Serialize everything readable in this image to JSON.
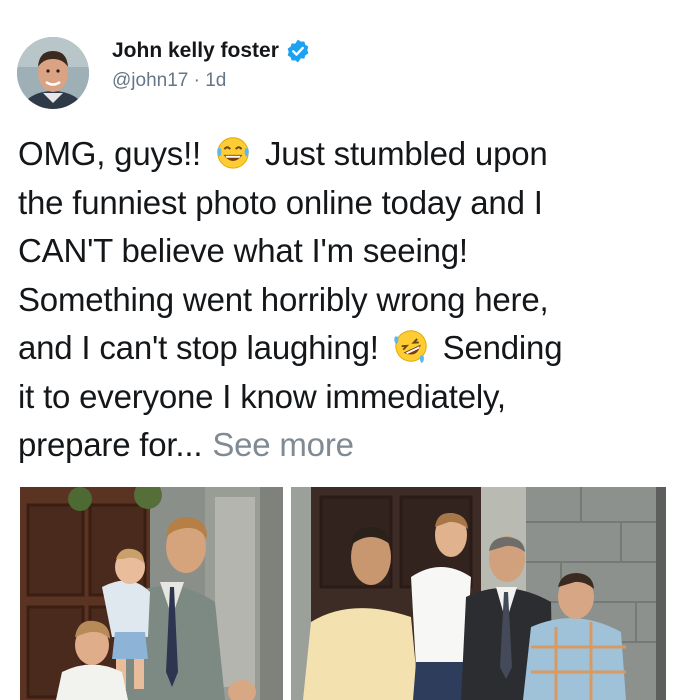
{
  "author": {
    "name": "John kelly foster",
    "handle": "@john17",
    "separator": " · ",
    "time": "1d",
    "verified": true,
    "avatar_icon": "profile-photo"
  },
  "tweet": {
    "lines": [
      {
        "before": "OMG, guys!!",
        "emoji": "laughing-tears-emoji",
        "after": "Just stumbled upon"
      },
      {
        "text": "the funniest photo online today and I"
      },
      {
        "text": "CAN'T believe what I'm seeing!"
      },
      {
        "text": "Something went horribly wrong here,"
      },
      {
        "before": "and I can't stop laughing!",
        "emoji": "rolling-laughing-emoji",
        "after": "Sending"
      },
      {
        "text": "it to everyone I know immediately,"
      },
      {
        "before": "prepare for...",
        "link": "See more"
      }
    ]
  },
  "media": {
    "images": [
      {
        "id": "left",
        "icon": "family-photo-then"
      },
      {
        "id": "right",
        "icon": "family-photo-now"
      }
    ]
  },
  "colors": {
    "verified_blue": "#1da1f2",
    "secondary_text": "#657786",
    "link_gray": "#808a93"
  }
}
